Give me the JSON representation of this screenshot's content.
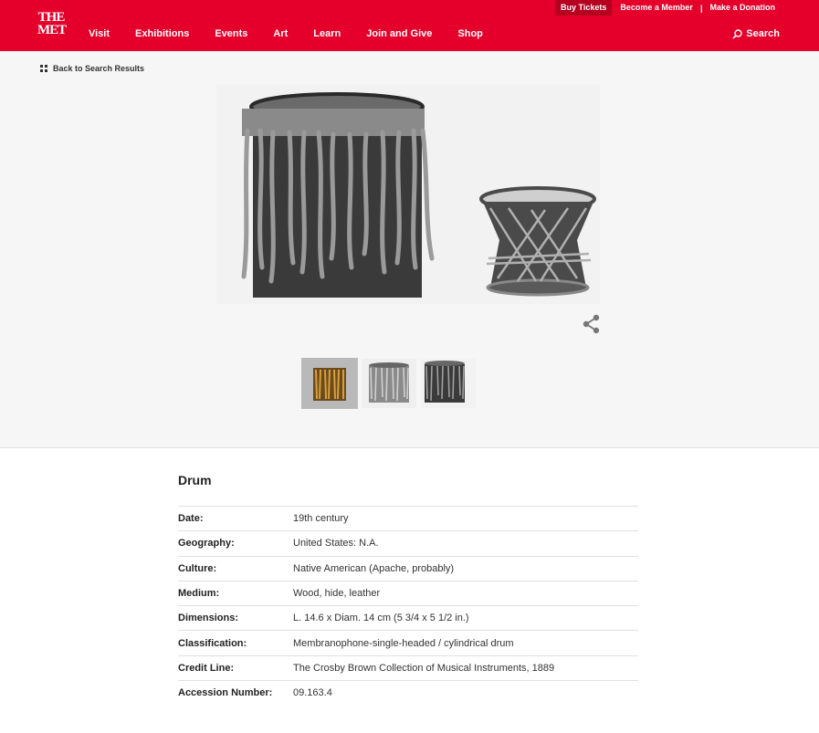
{
  "header": {
    "logo_line1": "THE",
    "logo_line2": "MET",
    "utility": {
      "buy_tickets": "Buy Tickets",
      "become_member": "Become a Member",
      "separator": "|",
      "make_donation": "Make a Donation"
    },
    "nav": [
      "Visit",
      "Exhibitions",
      "Events",
      "Art",
      "Learn",
      "Join and Give",
      "Shop"
    ],
    "search_label": "Search",
    "brand_color": "#e4002b"
  },
  "back_link": "Back to Search Results",
  "object": {
    "title": "Drum",
    "fields": [
      {
        "label": "Date:",
        "value": "19th century"
      },
      {
        "label": "Geography:",
        "value": "United States: N.A."
      },
      {
        "label": "Culture:",
        "value": "Native American (Apache, probably)"
      },
      {
        "label": "Medium:",
        "value": "Wood, hide, leather"
      },
      {
        "label": "Dimensions:",
        "value": "L. 14.6 x Diam. 14 cm (5 3/4 x 5 1/2 in.)"
      },
      {
        "label": "Classification:",
        "value": "Membranophone-single-headed / cylindrical drum"
      },
      {
        "label": "Credit Line:",
        "value": "The Crosby Brown Collection of Musical Instruments, 1889"
      },
      {
        "label": "Accession Number:",
        "value": "09.163.4"
      }
    ]
  },
  "icons": {
    "back": "grid-icon",
    "search": "search-icon",
    "share": "share-icon"
  }
}
